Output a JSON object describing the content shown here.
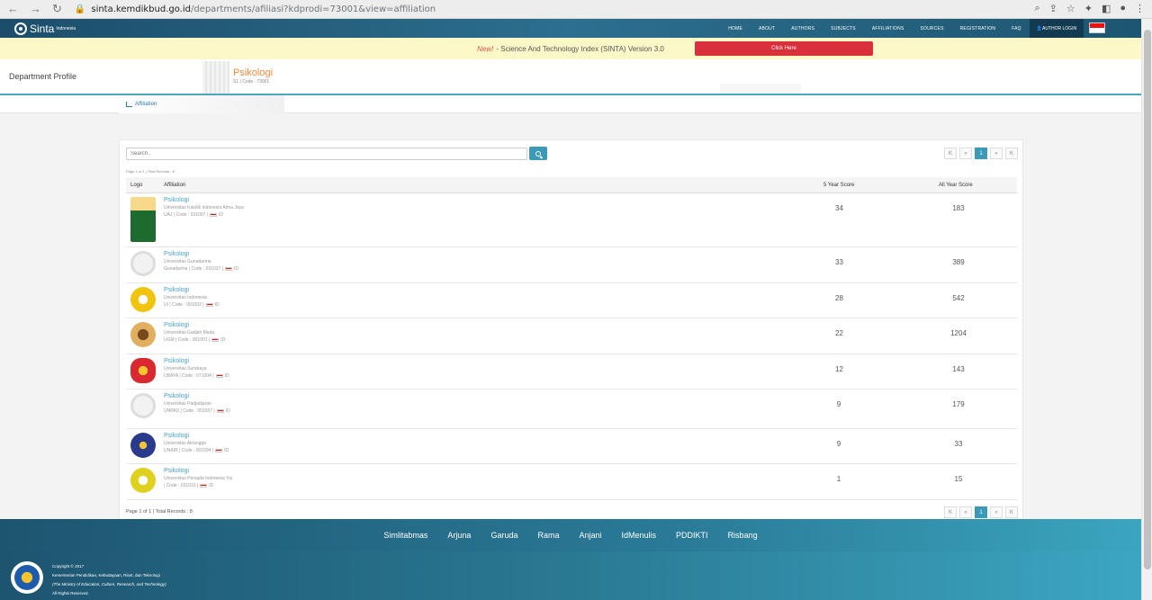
{
  "browser": {
    "url_host": "sinta.kemdikbud.go.id",
    "url_path": "/departments/afiliasi?kdprodi=73001&view=affiliation"
  },
  "nav": {
    "logo": "Sinta",
    "logo_sup": "Indonesia",
    "items": [
      "HOME",
      "ABOUT",
      "AUTHORS",
      "SUBJECTS",
      "AFFILIATIONS",
      "SOURCES",
      "REGISTRATION",
      "FAQ"
    ],
    "login": "AUTHOR LOGIN"
  },
  "announcement": {
    "new": "New!",
    "text": "- Science And Technology Index (SINTA) Version 3.0",
    "button": "Click Here"
  },
  "profile": {
    "label": "Department Profile",
    "title": "Psikologi",
    "sub": "S1 | Code : 73001"
  },
  "subnav": {
    "tab": "Affiliation"
  },
  "search": {
    "placeholder": "Search.."
  },
  "pagination": {
    "first": "K",
    "prev": "«",
    "current": "1",
    "next": "»",
    "last": "K"
  },
  "page_info_top": "Page 1 of 1 | Total Records : 8",
  "page_info_bottom": "Page 1 of 1 | Total Records : 8",
  "table": {
    "headers": {
      "logo": "Logo",
      "affiliation": "Affiliation",
      "score5": "5 Year Score",
      "scoreall": "All Year Score"
    },
    "rows": [
      {
        "name": "Psikologi",
        "univ": "Universitas Katolik Indonesia Atma Jaya",
        "code": "UAJ | Code : 031007 |",
        "country": "ID",
        "s5": "34",
        "sa": "183"
      },
      {
        "name": "Psikologi",
        "univ": "Universitas Gunadarma",
        "code": "Gunadarma | Code : 031037 |",
        "country": "ID",
        "s5": "33",
        "sa": "389"
      },
      {
        "name": "Psikologi",
        "univ": "Universitas Indonesia",
        "code": "UI | Code : 001002 |",
        "country": "ID",
        "s5": "28",
        "sa": "542"
      },
      {
        "name": "Psikologi",
        "univ": "Universitas Gadjah Mada",
        "code": "UGM | Code : 001001 |",
        "country": "ID",
        "s5": "22",
        "sa": "1204"
      },
      {
        "name": "Psikologi",
        "univ": "Universitas Surabaya",
        "code": "UBAYA | Code : 071004 |",
        "country": "ID",
        "s5": "12",
        "sa": "143"
      },
      {
        "name": "Psikologi",
        "univ": "Universitas Padjadjaran",
        "code": "UNPAD | Code : 001007 |",
        "country": "ID",
        "s5": "9",
        "sa": "179"
      },
      {
        "name": "Psikologi",
        "univ": "Universitas Airlangga",
        "code": "UNAIR | Code : 001004 |",
        "country": "ID",
        "s5": "9",
        "sa": "33"
      },
      {
        "name": "Psikologi",
        "univ": "Universitas Persada Indonesia Yai",
        "code": "| Code : 031010 |",
        "country": "ID",
        "s5": "1",
        "sa": "15"
      }
    ]
  },
  "footer_links": [
    "Simlitabmas",
    "Arjuna",
    "Garuda",
    "Rama",
    "Anjani",
    "IdMenulis",
    "PDDIKTI",
    "Risbang"
  ],
  "footer": {
    "line1": "Copyright © 2017",
    "line2": "Kementerian Pendidikan, Kebudayaan, Riset, dan Teknologi",
    "line3": "(The Ministry of Education, Culture, Research, and Technology)",
    "line4": "All Rights Reserved."
  }
}
